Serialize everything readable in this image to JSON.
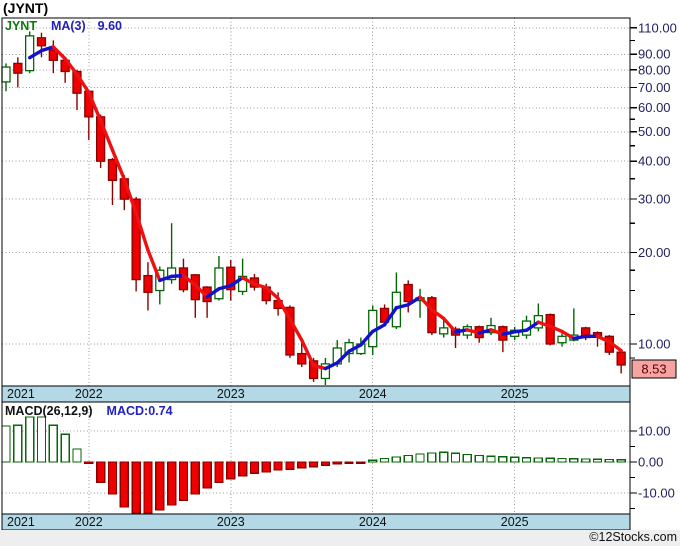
{
  "title": "(JYNT)",
  "legend": {
    "symbol": "JYNT",
    "ma_label": "MA(3)",
    "ma_value": "9.60"
  },
  "macd": {
    "label": "MACD(26,12,9)",
    "value_label": "MACD:0.74"
  },
  "copyright": "©12Stocks.com",
  "colors": {
    "candle_down_fill": "#ee0000",
    "candle_down_border": "#8b0000",
    "candle_up_fill": "#ffffff",
    "candle_up_border": "#056605",
    "ma_up": "#1212cc",
    "ma_down": "#ee1111",
    "band_fill": "#b3d9e6",
    "grid": "#9a9a9a",
    "axis_text": "#1f1f5f",
    "year_text": "#111111",
    "last_price_bg": "#f5a3a3",
    "last_price_text": "#5a0000",
    "frame": "#000000"
  },
  "chart_data": [
    {
      "type": "candlestick",
      "title": "JYNT monthly price with MA(3) overlay",
      "scale": "log",
      "columns": [
        "month",
        "open",
        "high",
        "low",
        "close"
      ],
      "candles": [
        [
          "2021-06",
          73.0,
          84.0,
          68.0,
          81.7
        ],
        [
          "2021-07",
          84.0,
          88.0,
          70.0,
          78.0
        ],
        [
          "2021-08",
          79.5,
          107.0,
          78.0,
          103.5
        ],
        [
          "2021-09",
          102.0,
          106.0,
          88.0,
          96.0
        ],
        [
          "2021-10",
          93.0,
          100.0,
          78.0,
          86.0
        ],
        [
          "2021-11",
          86.0,
          87.0,
          72.5,
          79.0
        ],
        [
          "2021-12",
          79.0,
          80.0,
          59.0,
          67.0
        ],
        [
          "2022-01",
          68.0,
          68.5,
          47.0,
          56.0
        ],
        [
          "2022-02",
          56.0,
          57.0,
          38.0,
          40.0
        ],
        [
          "2022-03",
          40.5,
          41.0,
          28.7,
          34.6
        ],
        [
          "2022-04",
          35.0,
          36.0,
          27.6,
          30.0
        ],
        [
          "2022-05",
          30.0,
          30.5,
          14.9,
          16.3
        ],
        [
          "2022-06",
          16.8,
          18.6,
          12.9,
          14.8
        ],
        [
          "2022-07",
          15.0,
          18.0,
          13.5,
          17.5
        ],
        [
          "2022-08",
          16.3,
          25.0,
          15.8,
          17.8
        ],
        [
          "2022-09",
          17.8,
          19.1,
          14.8,
          15.1
        ],
        [
          "2022-10",
          16.9,
          17.0,
          12.2,
          14.0
        ],
        [
          "2022-11",
          15.4,
          15.5,
          12.2,
          13.8
        ],
        [
          "2022-12",
          14.1,
          19.5,
          13.9,
          17.8
        ],
        [
          "2023-01",
          17.9,
          18.9,
          13.9,
          15.1
        ],
        [
          "2023-02",
          14.9,
          19.1,
          14.5,
          16.7
        ],
        [
          "2023-03",
          16.5,
          17.0,
          15.0,
          15.4
        ],
        [
          "2023-04",
          15.4,
          15.8,
          13.5,
          13.9
        ],
        [
          "2023-05",
          13.9,
          14.8,
          12.4,
          13.1
        ],
        [
          "2023-06",
          13.2,
          13.4,
          9.0,
          9.2
        ],
        [
          "2023-07",
          9.3,
          10.3,
          8.4,
          8.6
        ],
        [
          "2023-08",
          8.8,
          9.0,
          7.5,
          7.7
        ],
        [
          "2023-09",
          7.7,
          9.0,
          7.3,
          8.6
        ],
        [
          "2023-10",
          8.6,
          10.3,
          8.4,
          9.7
        ],
        [
          "2023-11",
          9.3,
          10.4,
          8.7,
          10.1
        ],
        [
          "2023-12",
          9.3,
          10.5,
          9.2,
          10.0
        ],
        [
          "2024-01",
          9.8,
          13.4,
          9.2,
          12.9
        ],
        [
          "2024-02",
          13.1,
          13.5,
          11.5,
          11.8
        ],
        [
          "2024-03",
          11.4,
          17.2,
          11.2,
          14.8
        ],
        [
          "2024-04",
          15.7,
          16.2,
          12.7,
          13.8
        ],
        [
          "2024-05",
          13.9,
          15.2,
          12.2,
          14.2
        ],
        [
          "2024-06",
          14.2,
          14.4,
          10.7,
          10.9
        ],
        [
          "2024-07",
          10.8,
          12.2,
          10.5,
          11.3
        ],
        [
          "2024-08",
          11.2,
          11.4,
          9.7,
          10.7
        ],
        [
          "2024-09",
          10.7,
          11.6,
          10.4,
          11.4
        ],
        [
          "2024-10",
          11.4,
          11.5,
          10.1,
          10.5
        ],
        [
          "2024-11",
          10.9,
          12.2,
          10.7,
          11.5
        ],
        [
          "2024-12",
          11.4,
          11.5,
          9.4,
          10.3
        ],
        [
          "2025-01",
          10.6,
          11.4,
          10.3,
          11.1
        ],
        [
          "2025-02",
          10.7,
          12.4,
          10.4,
          11.9
        ],
        [
          "2025-03",
          11.3,
          13.6,
          11.0,
          12.4
        ],
        [
          "2025-04",
          12.5,
          12.6,
          9.9,
          10.0
        ],
        [
          "2025-05",
          10.1,
          10.9,
          9.8,
          10.6
        ],
        [
          "2025-06",
          10.3,
          13.1,
          10.2,
          10.7
        ],
        [
          "2025-07",
          11.3,
          11.4,
          10.3,
          10.5
        ],
        [
          "2025-08",
          10.9,
          11.0,
          9.8,
          10.6
        ],
        [
          "2025-09",
          10.6,
          10.7,
          9.2,
          9.4
        ],
        [
          "2025-10",
          9.4,
          9.5,
          8.0,
          8.53
        ]
      ],
      "overlay": {
        "name": "MA(3)",
        "period": 3,
        "current_value": 9.6
      },
      "last_price_label": "8.53",
      "y_axis": {
        "tick_labels": [
          "110.00",
          "90.00",
          "80.00",
          "70.00",
          "60.00",
          "50.00",
          "40.00",
          "30.00",
          "20.00",
          "10.00"
        ],
        "tick_values": [
          110,
          90,
          80,
          70,
          60,
          50,
          40,
          30,
          20,
          10
        ],
        "minor_ticks": [
          100,
          55,
          45,
          35,
          25,
          17.5,
          15,
          12.5,
          9
        ],
        "range": [
          7.3,
          115
        ],
        "grid": "dotted"
      },
      "x_axis": {
        "year_labels": [
          "2021",
          "2022",
          "2023",
          "2024",
          "2025"
        ],
        "year_start_indices": [
          7,
          19,
          31,
          43
        ]
      }
    },
    {
      "type": "bar",
      "title": "MACD(26,12,9) histogram",
      "aligned_with_candles": true,
      "values": [
        11.6,
        11.9,
        14.5,
        14.5,
        11.9,
        9.0,
        4.2,
        -0.5,
        -6.5,
        -10.3,
        -14.5,
        -16.5,
        -16.8,
        -15.5,
        -13.9,
        -12.3,
        -10.3,
        -8.4,
        -6.6,
        -5.4,
        -4.4,
        -3.6,
        -3.2,
        -2.6,
        -2.3,
        -1.9,
        -1.5,
        -1.0,
        -0.6,
        -0.3,
        -0.1,
        0.6,
        1.1,
        1.6,
        2.1,
        2.6,
        2.9,
        3.1,
        2.8,
        2.4,
        2.1,
        1.9,
        1.7,
        1.5,
        1.4,
        1.3,
        1.2,
        1.1,
        1.0,
        0.95,
        0.9,
        0.8,
        0.74
      ],
      "current_value": 0.74,
      "y_axis": {
        "tick_labels": [
          "10.00",
          "0.00",
          "-10.00"
        ],
        "tick_values": [
          10,
          0,
          -10
        ],
        "minor_ticks": [
          5,
          -5,
          -15
        ],
        "grid": "dotted"
      }
    }
  ]
}
